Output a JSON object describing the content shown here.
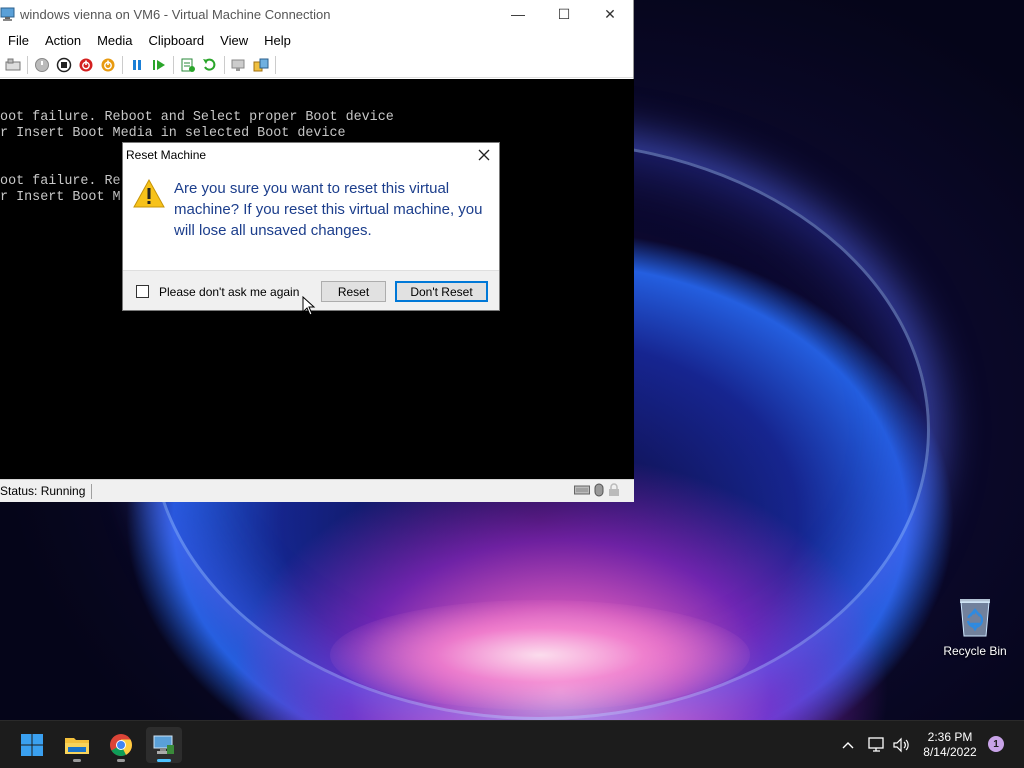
{
  "window": {
    "title": "windows vienna on VM6 - Virtual Machine Connection",
    "minimize_glyph": "—",
    "maximize_glyph": "☐",
    "close_glyph": "✕"
  },
  "menu": [
    "File",
    "Action",
    "Media",
    "Clipboard",
    "View",
    "Help"
  ],
  "toolbar_icons": [
    "ctrl-alt-del-icon",
    "start-icon",
    "turn-off-icon",
    "shut-down-icon",
    "save-icon",
    "pause-icon",
    "resume-icon",
    "checkpoint-icon",
    "revert-icon",
    "enhanced-session-icon",
    "share-icon"
  ],
  "console": {
    "lines": [
      "Boot failure. Reboot and Select proper Boot device",
      "or Insert Boot Media in selected Boot device",
      "",
      "Boot failure. Re",
      "or Insert Boot M"
    ]
  },
  "statusbar": {
    "status": "Status: Running"
  },
  "dialog": {
    "title": "Reset Machine",
    "message": "Are you sure you want to reset this virtual machine? If you reset this virtual machine, you will lose all unsaved changes.",
    "checkbox_label": "Please don't ask me again",
    "checkbox_checked": false,
    "reset_label": "Reset",
    "dont_reset_label": "Don't Reset"
  },
  "desktop": {
    "recycle_bin_label": "Recycle Bin"
  },
  "taskbar": {
    "apps": [
      "start-button",
      "file-explorer",
      "chrome",
      "hyper-v-vm-connection"
    ],
    "active_app": "hyper-v-vm-connection",
    "time": "2:36 PM",
    "date": "8/14/2022",
    "notification_count": "1"
  },
  "colors": {
    "dialog_text": "#1c3e8c",
    "focus_border": "#0078d7",
    "taskbar": "#1c1c1c"
  }
}
